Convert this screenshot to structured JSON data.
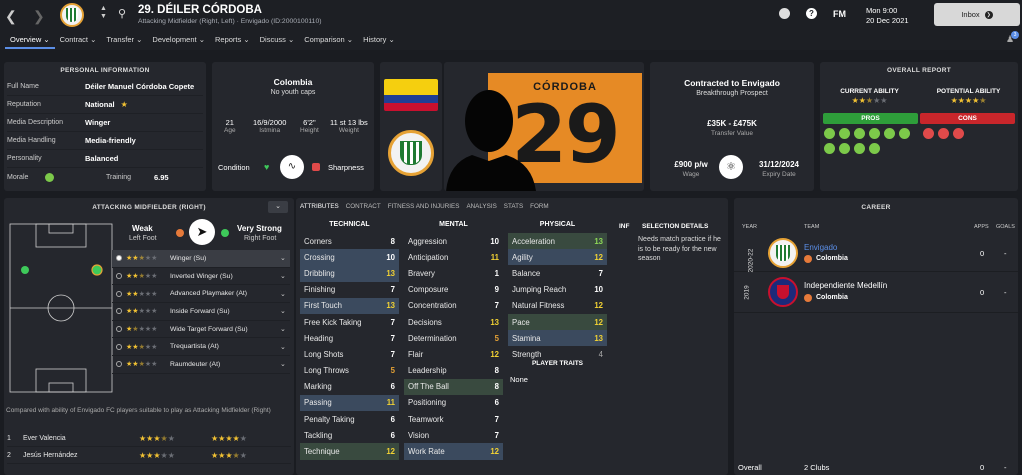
{
  "header": {
    "title": "29. DÉILER CÓRDOBA",
    "subtitle": "Attacking Midfielder (Right, Left) · Envigado (ID:2000100110)",
    "time": "Mon 9:00",
    "date": "20 Dec 2021",
    "fm": "FM",
    "inbox": "Inbox",
    "notif_count": "3"
  },
  "nav": [
    "Overview",
    "Contract",
    "Transfer",
    "Development",
    "Reports",
    "Discuss",
    "Comparison",
    "History"
  ],
  "personal": {
    "title": "PERSONAL INFORMATION",
    "rows": [
      {
        "label": "Full Name",
        "value": "Déiler Manuel Córdoba Copete"
      },
      {
        "label": "Reputation",
        "value": "National"
      },
      {
        "label": "Media Description",
        "value": "Winger"
      },
      {
        "label": "Media Handling",
        "value": "Media-friendly"
      },
      {
        "label": "Personality",
        "value": "Balanced"
      }
    ],
    "morale_label": "Morale",
    "training_label": "Training",
    "training_value": "6.95"
  },
  "nation": {
    "name": "Colombia",
    "caps": "No youth caps",
    "stats": [
      {
        "v": "21",
        "l": "Age"
      },
      {
        "v": "16/9/2000",
        "l": "Istmina"
      },
      {
        "v": "6'2\"",
        "l": "Height"
      },
      {
        "v": "11 st 13 lbs",
        "l": "Weight"
      }
    ],
    "condition": "Condition",
    "sharpness": "Sharpness"
  },
  "shirt": {
    "name": "CÓRDOBA",
    "number": "29"
  },
  "contract": {
    "title": "Contracted to Envigado",
    "sub": "Breakthrough Prospect",
    "value": "£35K - £475K",
    "value_label": "Transfer Value",
    "wage": "£900 p/w",
    "wage_label": "Wage",
    "expiry": "31/12/2024",
    "expiry_label": "Expiry Date"
  },
  "report": {
    "title": "OVERALL REPORT",
    "current": "CURRENT ABILITY",
    "potential": "POTENTIAL ABILITY",
    "current_stars": 2.5,
    "potential_stars": 4.5,
    "pros": "PROS",
    "cons": "CONS"
  },
  "position": {
    "title": "ATTACKING MIDFIELDER (RIGHT)",
    "weak": "Weak",
    "left_foot": "Left Foot",
    "strong": "Very Strong",
    "right_foot": "Right Foot",
    "roles": [
      {
        "stars": 2.5,
        "name": "Winger (Su)"
      },
      {
        "stars": 2.5,
        "name": "Inverted Winger (Su)"
      },
      {
        "stars": 2,
        "name": "Advanced Playmaker (At)"
      },
      {
        "stars": 2,
        "name": "Inside Forward (Su)"
      },
      {
        "stars": 1.5,
        "name": "Wide Target Forward (Su)"
      },
      {
        "stars": 2.5,
        "name": "Trequartista (At)"
      },
      {
        "stars": 2.5,
        "name": "Raumdeuter (At)"
      }
    ],
    "compare_text": "Compared with ability of Envigado FC players suitable to play as Attacking Midfielder (Right)",
    "compare": [
      {
        "n": "1",
        "name": "Ever Valencia",
        "a": 3.5,
        "b": 4
      },
      {
        "n": "2",
        "name": "Jesús Hernández",
        "a": 3,
        "b": 3.5
      }
    ]
  },
  "tabs": [
    "ATTRIBUTES",
    "CONTRACT",
    "FITNESS AND INJURIES",
    "ANALYSIS",
    "STATS",
    "FORM"
  ],
  "technical": {
    "title": "TECHNICAL",
    "rows": [
      {
        "n": "Corners",
        "v": "8",
        "c": "w",
        "h": ""
      },
      {
        "n": "Crossing",
        "v": "10",
        "c": "w",
        "h": "hl"
      },
      {
        "n": "Dribbling",
        "v": "13",
        "c": "y",
        "h": "hl"
      },
      {
        "n": "Finishing",
        "v": "7",
        "c": "w",
        "h": ""
      },
      {
        "n": "First Touch",
        "v": "13",
        "c": "y",
        "h": "hl"
      },
      {
        "n": "Free Kick Taking",
        "v": "7",
        "c": "w",
        "h": ""
      },
      {
        "n": "Heading",
        "v": "7",
        "c": "w",
        "h": ""
      },
      {
        "n": "Long Shots",
        "v": "7",
        "c": "w",
        "h": ""
      },
      {
        "n": "Long Throws",
        "v": "5",
        "c": "o",
        "h": ""
      },
      {
        "n": "Marking",
        "v": "6",
        "c": "w",
        "h": ""
      },
      {
        "n": "Passing",
        "v": "11",
        "c": "y",
        "h": "hl"
      },
      {
        "n": "Penalty Taking",
        "v": "6",
        "c": "w",
        "h": ""
      },
      {
        "n": "Tackling",
        "v": "6",
        "c": "w",
        "h": ""
      },
      {
        "n": "Technique",
        "v": "12",
        "c": "y",
        "h": "gr"
      }
    ]
  },
  "mental": {
    "title": "MENTAL",
    "rows": [
      {
        "n": "Aggression",
        "v": "10",
        "c": "w",
        "h": ""
      },
      {
        "n": "Anticipation",
        "v": "11",
        "c": "y",
        "h": ""
      },
      {
        "n": "Bravery",
        "v": "1",
        "c": "w",
        "h": ""
      },
      {
        "n": "Composure",
        "v": "9",
        "c": "w",
        "h": ""
      },
      {
        "n": "Concentration",
        "v": "7",
        "c": "w",
        "h": ""
      },
      {
        "n": "Decisions",
        "v": "13",
        "c": "y",
        "h": ""
      },
      {
        "n": "Determination",
        "v": "5",
        "c": "o",
        "h": ""
      },
      {
        "n": "Flair",
        "v": "12",
        "c": "y",
        "h": ""
      },
      {
        "n": "Leadership",
        "v": "8",
        "c": "w",
        "h": ""
      },
      {
        "n": "Off The Ball",
        "v": "8",
        "c": "w",
        "h": "gr"
      },
      {
        "n": "Positioning",
        "v": "6",
        "c": "w",
        "h": ""
      },
      {
        "n": "Teamwork",
        "v": "7",
        "c": "w",
        "h": ""
      },
      {
        "n": "Vision",
        "v": "7",
        "c": "w",
        "h": ""
      },
      {
        "n": "Work Rate",
        "v": "12",
        "c": "y",
        "h": "hl"
      }
    ]
  },
  "physical": {
    "title": "PHYSICAL",
    "rows": [
      {
        "n": "Acceleration",
        "v": "13",
        "c": "g",
        "h": "gr"
      },
      {
        "n": "Agility",
        "v": "12",
        "c": "y",
        "h": "hl"
      },
      {
        "n": "Balance",
        "v": "7",
        "c": "w",
        "h": ""
      },
      {
        "n": "Jumping Reach",
        "v": "10",
        "c": "w",
        "h": ""
      },
      {
        "n": "Natural Fitness",
        "v": "12",
        "c": "y",
        "h": ""
      },
      {
        "n": "Pace",
        "v": "12",
        "c": "y",
        "h": "gr"
      },
      {
        "n": "Stamina",
        "v": "13",
        "c": "y",
        "h": "hl"
      },
      {
        "n": "Strength",
        "v": "4",
        "c": "d",
        "h": ""
      }
    ]
  },
  "traits": {
    "title": "PLAYER TRAITS",
    "value": "None"
  },
  "inf": "INF",
  "selection": {
    "title": "SELECTION DETAILS",
    "text": "Needs match practice if he is to be ready for the new season"
  },
  "career": {
    "title": "CAREER",
    "year": "YEAR",
    "team": "TEAM",
    "apps": "APPS",
    "goals": "GOALS",
    "rows": [
      {
        "year": "2020-22",
        "team": "Envigado",
        "nation": "Colombia",
        "apps": "0",
        "goals": "-"
      },
      {
        "year": "2019",
        "team": "Independiente Medellín",
        "nation": "Colombia",
        "apps": "0",
        "goals": "-"
      }
    ],
    "overall": "Overall",
    "clubs": "2 Clubs",
    "total_apps": "0",
    "total_goals": "-"
  },
  "colors": {
    "accent": "#5b8ee6",
    "pros": "#2e9e3a",
    "cons": "#c9262b",
    "star": "#f2c233"
  }
}
